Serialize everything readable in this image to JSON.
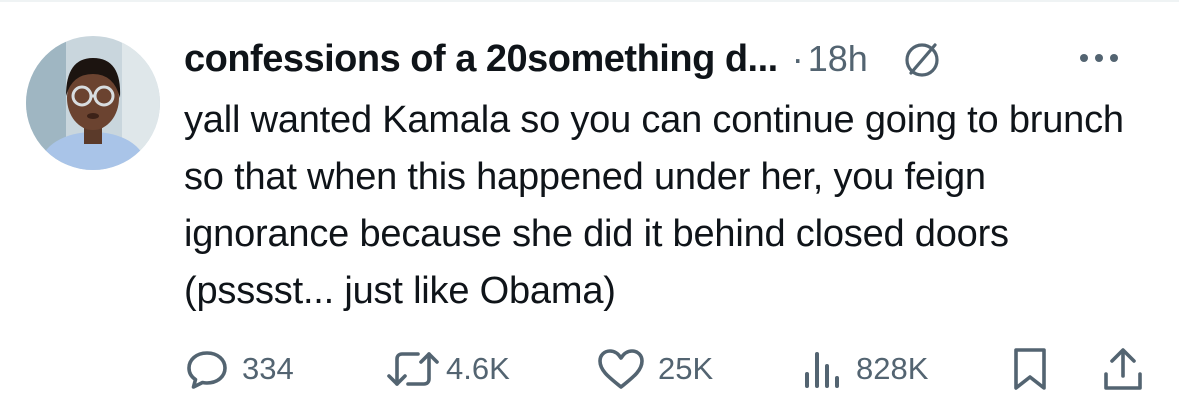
{
  "tweet": {
    "author_name": "confessions of a 20something d...",
    "separator": "·",
    "time": "18h",
    "text": "yall wanted Kamala so you can continue going to brunch so that when this happened under her, you feign ignorance because she did it behind closed doors (psssst... just like Obama)",
    "icons": {
      "avatar": "avatar-photo",
      "status": "circle-slash-icon",
      "more": "more-dots-icon"
    },
    "actions": {
      "replies": "334",
      "reposts": "4.6K",
      "likes": "25K",
      "views": "828K"
    },
    "colors": {
      "text": "#0f1419",
      "secondary": "#536471",
      "divider": "#eff3f4"
    }
  }
}
